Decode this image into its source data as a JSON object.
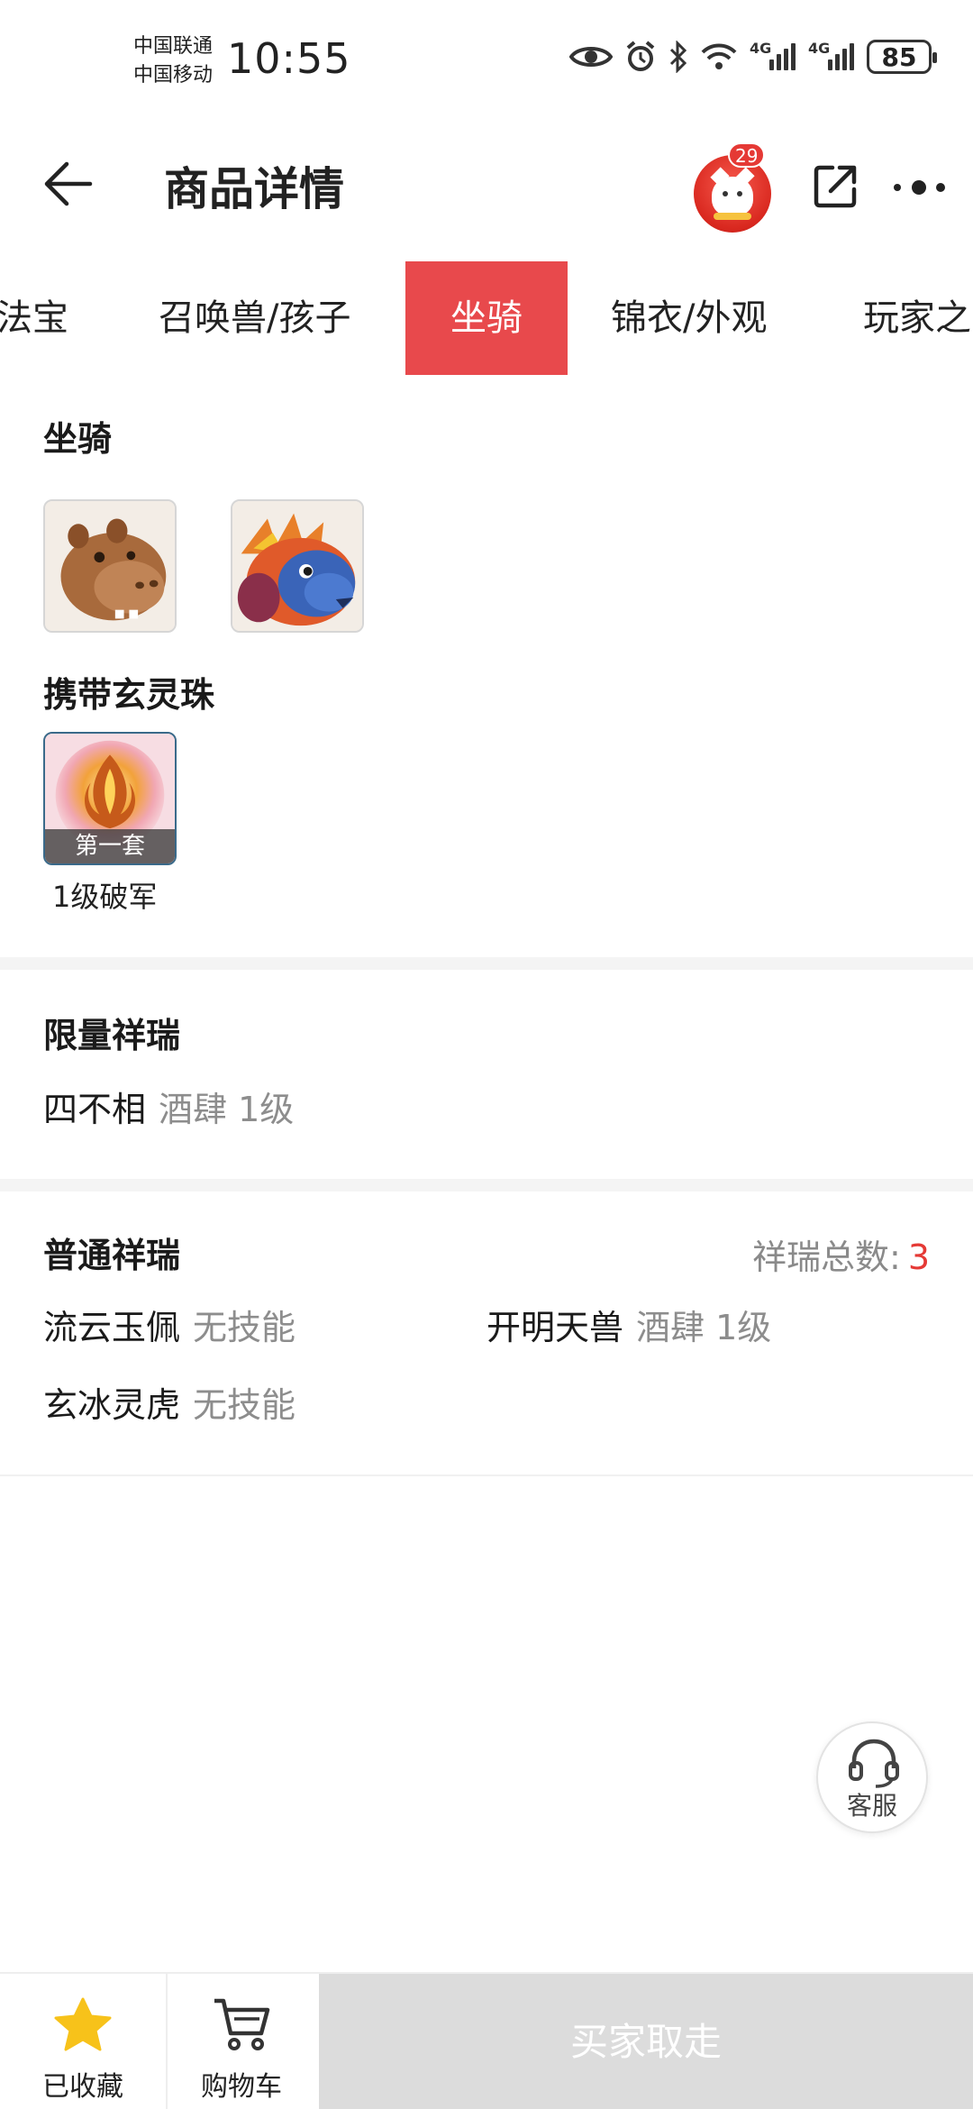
{
  "status_bar": {
    "carrier_1": "中国联通",
    "carrier_2": "中国移动",
    "time": "10:55",
    "network_1": "4G",
    "network_2": "4G",
    "battery": "85"
  },
  "header": {
    "title": "商品详情",
    "message_badge": "29"
  },
  "tabs": [
    {
      "label": "法宝",
      "active": false
    },
    {
      "label": "召唤兽/孩子",
      "active": false
    },
    {
      "label": "坐骑",
      "active": true
    },
    {
      "label": "锦衣/外观",
      "active": false
    },
    {
      "label": "玩家之"
    }
  ],
  "mounts_section": {
    "title": "坐骑",
    "mounts": [
      {
        "icon": "hippo-mount-icon"
      },
      {
        "icon": "dragon-mount-icon"
      }
    ]
  },
  "pearl_section": {
    "title": "携带玄灵珠",
    "pearl": {
      "set_label": "第一套",
      "name": "1级破军",
      "icon": "fire-pearl-icon"
    }
  },
  "limited_section": {
    "title": "限量祥瑞",
    "items": [
      {
        "name": "四不相",
        "detail": "酒肆 1级"
      }
    ]
  },
  "normal_section": {
    "title": "普通祥瑞",
    "total_label": "祥瑞总数:",
    "total_value": "3",
    "items": [
      {
        "name": "流云玉佩",
        "detail": "无技能"
      },
      {
        "name": "开明天兽",
        "detail": "酒肆 1级"
      },
      {
        "name": "玄冰灵虎",
        "detail": "无技能"
      }
    ]
  },
  "service": {
    "label": "客服"
  },
  "bottom_bar": {
    "favorite_label": "已收藏",
    "cart_label": "购物车",
    "buy_label": "买家取走"
  },
  "colors": {
    "accent": "#e8494c",
    "badge": "#e53935",
    "star": "#f7c21a",
    "muted_text": "#8d8d8d",
    "disabled_button": "#dcdcdc"
  }
}
